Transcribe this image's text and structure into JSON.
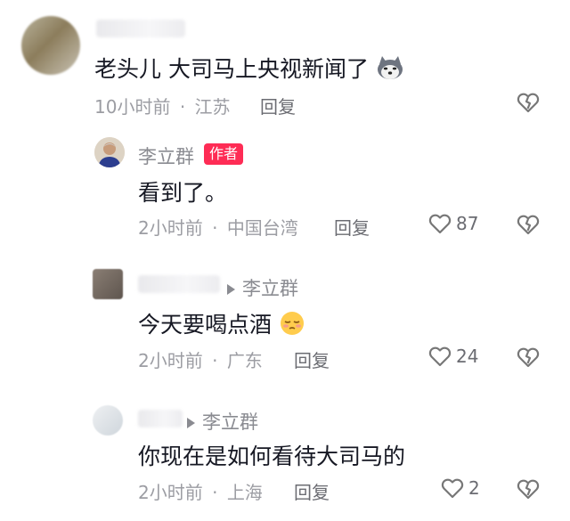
{
  "comments": [
    {
      "text": "老头儿  大司马上央视新闻了",
      "emoji": "husky-emoji",
      "time": "10小时前",
      "sep": "·",
      "location": "江苏",
      "reply_label": "回复"
    },
    {
      "author": "李立群",
      "author_badge": "作者",
      "text": "看到了。",
      "time": "2小时前",
      "sep": "·",
      "location": "中国台湾",
      "reply_label": "回复",
      "likes": "87"
    },
    {
      "reply_to": "李立群",
      "text": "今天要喝点酒",
      "emoji": "sleepy-face-emoji",
      "time": "2小时前",
      "sep": "·",
      "location": "广东",
      "reply_label": "回复",
      "likes": "24"
    },
    {
      "reply_to": "李立群",
      "text": "你现在是如何看待大司马的",
      "time": "2小时前",
      "sep": "·",
      "location": "上海",
      "reply_label": "回复",
      "likes": "2"
    }
  ],
  "colors": {
    "badge": "#fe2c55",
    "meta": "#9c9da3",
    "name": "#8a8b91"
  }
}
